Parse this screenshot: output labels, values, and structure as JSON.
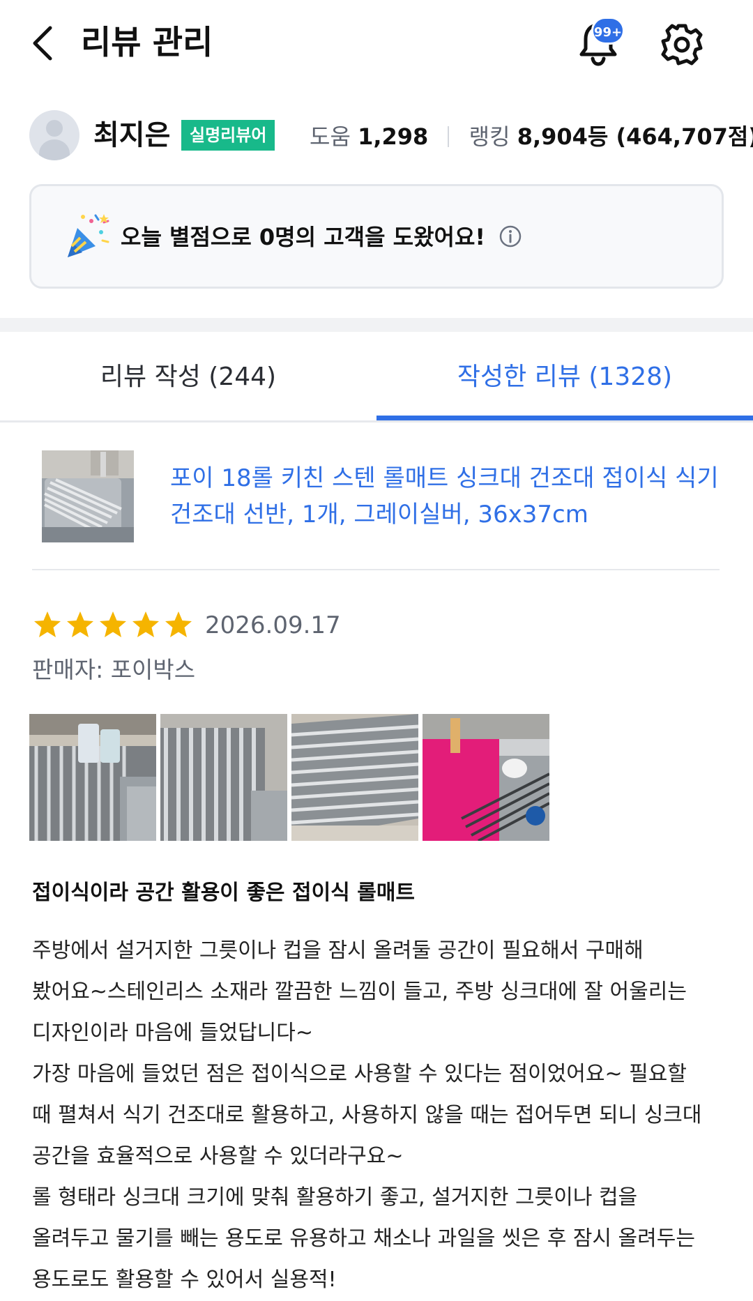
{
  "header": {
    "title": "리뷰 관리",
    "notification_badge": "99+"
  },
  "profile": {
    "name": "최지은",
    "badge": "실명리뷰어",
    "help_label": "도움",
    "help_count": "1,298",
    "ranking_label": "랭킹",
    "ranking_value": "8,904등 (464,707점)"
  },
  "help_card": {
    "message": "오늘 별점으로 0명의 고객을 도왔어요!"
  },
  "tabs": [
    {
      "label": "리뷰 작성 (244)",
      "active": false
    },
    {
      "label": "작성한 리뷰 (1328)",
      "active": true
    }
  ],
  "review": {
    "product_title": "포이 18롤 키친 스텐 롤매트 싱크대 건조대 접이식 식기 건조대 선반, 1개, 그레이실버, 36x37cm",
    "rating": 5,
    "date": "2026.09.17",
    "seller_label": "판매자: 포이박스",
    "headline": "접이식이라 공간 활용이 좋은 접이식 롤매트",
    "body_lines": [
      "주방에서 설거지한 그릇이나 컵을 잠시 올려둘 공간이 필요해서 구매해",
      "봤어요~스테인리스 소재라 깔끔한 느낌이 들고, 주방 싱크대에 잘 어울리는",
      "디자인이라 마음에 들었답니다~",
      "가장 마음에 들었던 점은 접이식으로 사용할 수 있다는 점이었어요~ 필요할",
      "때 펼쳐서 식기 건조대로 활용하고, 사용하지 않을 때는 접어두면 되니 싱크대",
      "공간을 효율적으로 사용할 수 있더라구요~",
      "롤 형태라 싱크대 크기에 맞춰 활용하기 좋고, 설거지한 그릇이나 컵을",
      "올려두고 물기를 빼는 용도로 유용하고 채소나 과일을 씻은 후 잠시 올려두는",
      "용도로도 활용할 수 있어서 실용적!"
    ]
  },
  "colors": {
    "accent": "#2f6fe6",
    "badge_green": "#18b98a",
    "star": "#f5b400"
  },
  "icons": [
    "back-arrow-icon",
    "bell-icon",
    "gear-icon",
    "party-popper-icon",
    "info-icon",
    "star-icon"
  ]
}
